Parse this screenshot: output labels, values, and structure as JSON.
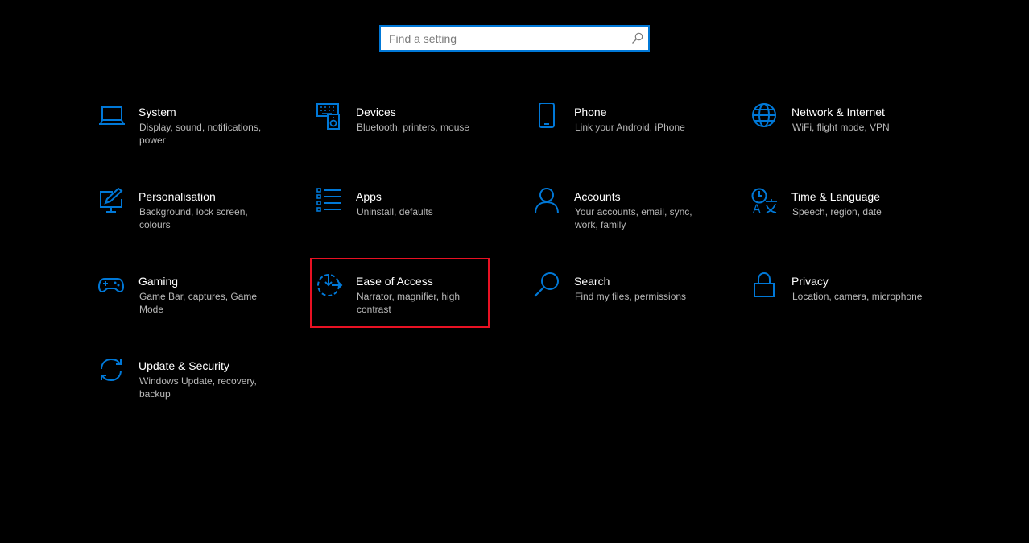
{
  "search": {
    "placeholder": "Find a setting",
    "value": ""
  },
  "accent_color": "#0078d7",
  "highlight_color": "#e81123",
  "tiles": [
    {
      "icon": "laptop-icon",
      "title": "System",
      "description": "Display, sound, notifications, power"
    },
    {
      "icon": "keyboard-speaker-icon",
      "title": "Devices",
      "description": "Bluetooth, printers, mouse"
    },
    {
      "icon": "phone-icon",
      "title": "Phone",
      "description": "Link your Android, iPhone"
    },
    {
      "icon": "globe-icon",
      "title": "Network & Internet",
      "description": "WiFi, flight mode, VPN"
    },
    {
      "icon": "pen-monitor-icon",
      "title": "Personalisation",
      "description": "Background, lock screen, colours"
    },
    {
      "icon": "list-icon",
      "title": "Apps",
      "description": "Uninstall, defaults"
    },
    {
      "icon": "person-icon",
      "title": "Accounts",
      "description": "Your accounts, email, sync, work, family"
    },
    {
      "icon": "time-language-icon",
      "title": "Time & Language",
      "description": "Speech, region, date"
    },
    {
      "icon": "gamepad-icon",
      "title": "Gaming",
      "description": "Game Bar, captures, Game Mode"
    },
    {
      "icon": "ease-of-access-icon",
      "title": "Ease of Access",
      "description": "Narrator, magnifier, high contrast"
    },
    {
      "icon": "magnifier-icon",
      "title": "Search",
      "description": "Find my files, permissions"
    },
    {
      "icon": "lock-icon",
      "title": "Privacy",
      "description": "Location, camera, microphone"
    },
    {
      "icon": "sync-icon",
      "title": "Update & Security",
      "description": "Windows Update, recovery, backup"
    }
  ]
}
